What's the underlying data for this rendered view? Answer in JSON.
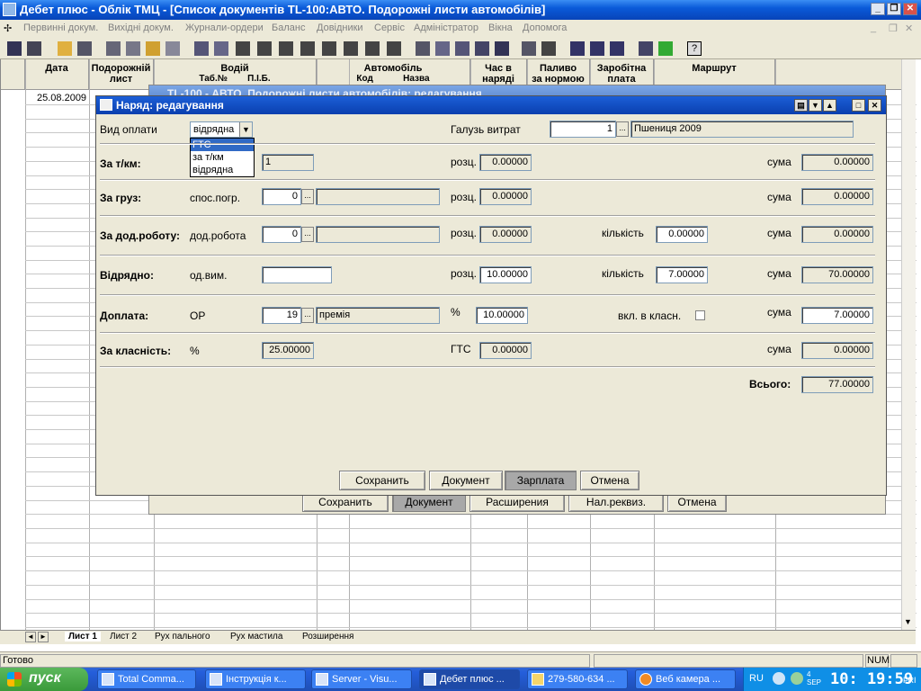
{
  "window": {
    "title": "Дебет плюс - Облік ТМЦ - [Список документів TL-100:АВТО. Подорожні листи автомобілів]"
  },
  "menu": [
    "Первинні докум.",
    "Вихідні докум.",
    "Журнали-ордери",
    "Баланс",
    "Довідники",
    "Сервіс",
    "Адміністратор",
    "Вікна",
    "Допомога"
  ],
  "grid": {
    "headers": {
      "date": "Дата",
      "waybill_1": "Подорожній",
      "waybill_2": "лист",
      "driver": "Водій",
      "tab_no": "Таб.№",
      "pib": "П.І.Б.",
      "vehicle": "Автомобіль",
      "code": "Код",
      "name": "Назва",
      "hours_1": "Час в",
      "hours_2": "наряді",
      "fuel_1": "Паливо",
      "fuel_2": "за нормою",
      "salary_1": "Заробітна",
      "salary_2": "плата",
      "route": "Маршрут"
    },
    "first_row_date": "25.08.2009"
  },
  "bg_dialog": {
    "title": "TL-100 - АВТО. Подорожні листи автомобілів: редагування",
    "buttons": [
      "Сохранить",
      "Документ",
      "Расширения",
      "Нал.реквиз.",
      "Отмена"
    ]
  },
  "dialog": {
    "title": "Наряд: редагування",
    "pay_type_label": "Вид оплати",
    "pay_type_value": "відрядна",
    "pay_type_options": [
      "ГТС",
      "за т/км",
      "відрядна"
    ],
    "cost_branch_label": "Галузь витрат",
    "cost_branch_code": "1",
    "cost_branch_name": "Пшениця 2009",
    "tkm": {
      "label": "За т/км:",
      "value": "1",
      "rate_label": "розц.",
      "rate": "0.00000",
      "sum_label": "сума",
      "sum": "0.00000"
    },
    "cargo": {
      "label": "За груз:",
      "sub_label": "спос.погр.",
      "code": "0",
      "name": "",
      "rate_label": "розц.",
      "rate": "0.00000",
      "sum_label": "сума",
      "sum": "0.00000"
    },
    "extra": {
      "label": "За дод.роботу:",
      "sub_label": "дод.робота",
      "code": "0",
      "name": "",
      "rate_label": "розц.",
      "rate": "0.00000",
      "qty_label": "кількість",
      "qty": "0.00000",
      "sum_label": "сума",
      "sum": "0.00000"
    },
    "piece": {
      "label": "Відрядно:",
      "sub_label": "од.вим.",
      "unit": "",
      "rate_label": "розц.",
      "rate": "10.00000",
      "qty_label": "кількість",
      "qty": "7.00000",
      "sum_label": "сума",
      "sum": "70.00000"
    },
    "bonus": {
      "label": "Доплата:",
      "sub_label": "ОР",
      "code": "19",
      "name": "премія",
      "pct_label": "%",
      "pct": "10.00000",
      "incl_label": "вкл. в класн.",
      "sum_label": "сума",
      "sum": "7.00000"
    },
    "class": {
      "label": "За класність:",
      "sub_label": "%",
      "pct": "25.00000",
      "gts_label": "ГТС",
      "gts": "0.00000",
      "sum_label": "сума",
      "sum": "0.00000"
    },
    "total_label": "Всього:",
    "total": "77.00000",
    "buttons": {
      "save": "Сохранить",
      "document": "Документ",
      "salary": "Зарплата",
      "cancel": "Отмена"
    }
  },
  "sheet_tabs": [
    "Лист 1",
    "Лист 2",
    "Рух пального",
    "Рух мастила",
    "Розширення"
  ],
  "status": {
    "text": "Готово",
    "num": "NUM"
  },
  "taskbar": {
    "start": "пуск",
    "items": [
      "Total Comma...",
      "Інструкція к...",
      "Server - Visu...",
      "Дебет плюс ...",
      "279-580-634 ...",
      "Веб камера ..."
    ],
    "lang": "RU",
    "date": "4 SEP",
    "time": "10: 19:59",
    "day": "FRI"
  }
}
